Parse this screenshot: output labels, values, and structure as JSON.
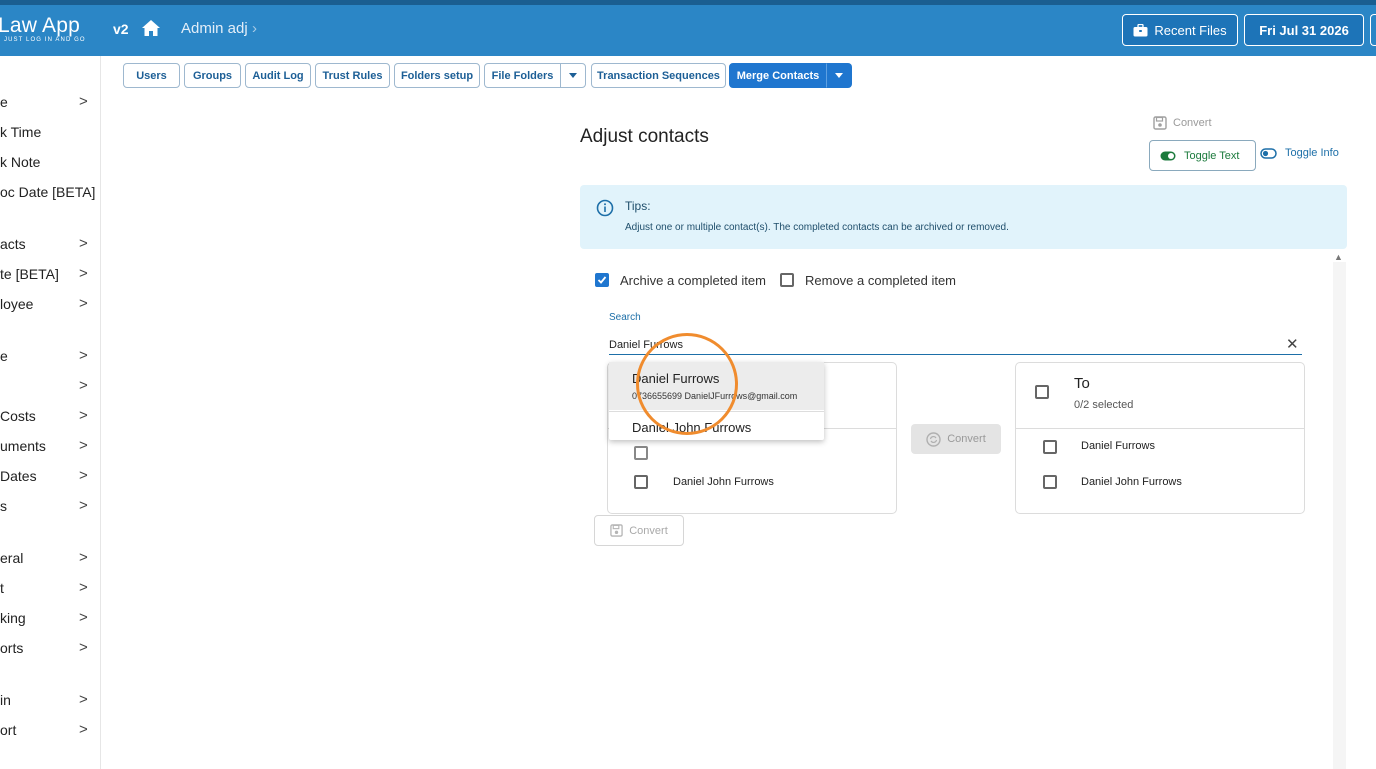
{
  "header": {
    "logo_text": "Law App",
    "logo_tagline": "JUST LOG IN AND GO",
    "version": "v2",
    "breadcrumb": "Admin adj",
    "recent_files_label": "Recent Files",
    "date_label": "Fri Jul 31 2026"
  },
  "sidebar": {
    "items": [
      {
        "label": "e",
        "chevron": ">"
      },
      {
        "label": "k Time",
        "chevron": ""
      },
      {
        "label": "k Note",
        "chevron": ""
      },
      {
        "label": "oc Date [BETA]",
        "chevron": ""
      },
      {
        "label": "acts",
        "chevron": ">"
      },
      {
        "label": "te [BETA]",
        "chevron": ">"
      },
      {
        "label": "loyee",
        "chevron": ">"
      },
      {
        "label": "e",
        "chevron": ">"
      },
      {
        "label": "",
        "chevron": ">"
      },
      {
        "label": "Costs",
        "chevron": ">"
      },
      {
        "label": "uments",
        "chevron": ">"
      },
      {
        "label": "Dates",
        "chevron": ">"
      },
      {
        "label": "s",
        "chevron": ">"
      },
      {
        "label": "eral",
        "chevron": ">"
      },
      {
        "label": "t",
        "chevron": ">"
      },
      {
        "label": "king",
        "chevron": ">"
      },
      {
        "label": "orts",
        "chevron": ">"
      },
      {
        "label": "in",
        "chevron": ">"
      },
      {
        "label": "ort",
        "chevron": ">"
      }
    ]
  },
  "tabs": {
    "users": "Users",
    "groups": "Groups",
    "audit_log": "Audit Log",
    "trust_rules": "Trust Rules",
    "folders_setup": "Folders setup",
    "file_folders": "File Folders",
    "transaction_sequences": "Transaction Sequences",
    "merge_contacts": "Merge Contacts"
  },
  "main": {
    "title": "Adjust contacts",
    "convert_top_label": "Convert",
    "toggle_text_label": "Toggle Text",
    "toggle_info_label": "Toggle Info",
    "tips_title": "Tips:",
    "tips_body": "Adjust one or multiple contact(s). The completed contacts can be archived or removed.",
    "archive_label": "Archive a completed item",
    "archive_checked": true,
    "remove_label": "Remove a completed item",
    "remove_checked": false,
    "search_label": "Search",
    "search_value": "Daniel Furrows",
    "from_rows": [
      "Daniel John Furrows"
    ],
    "mid_convert_label": "Convert",
    "bottom_convert_label": "Convert",
    "to_title": "To",
    "to_subtitle": "0/2 selected",
    "to_rows": [
      "Daniel Furrows",
      "Daniel John Furrows"
    ]
  },
  "dropdown": {
    "option1_name": "Daniel Furrows",
    "option1_detail": "0736655699 DanielJFurrows@gmail.com",
    "option2_name": "Daniel John Furrows"
  },
  "colors": {
    "header_blue": "#2b86c6",
    "accent_blue": "#1f76cf",
    "tips_bg": "#e1f3fb",
    "highlight_orange": "#f08c2e"
  },
  "icons": [
    "home-icon",
    "briefcase-icon",
    "chevron-right-icon",
    "caret-down-icon",
    "save-icon",
    "toggle-on-icon",
    "toggle-off-icon",
    "info-icon",
    "close-icon",
    "sync-icon",
    "scroll-up-icon"
  ]
}
